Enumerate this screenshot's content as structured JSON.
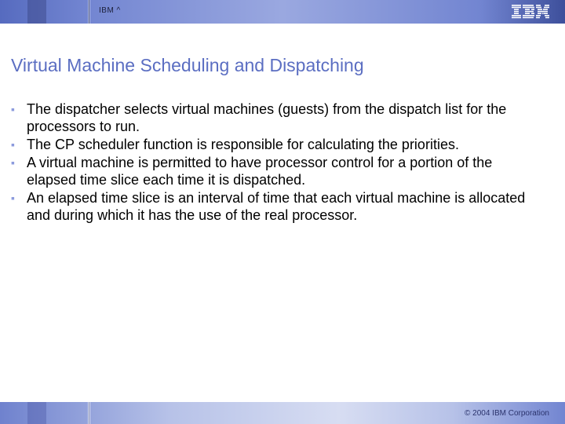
{
  "header": {
    "brand": "IBM ^",
    "logo_alt": "IBM"
  },
  "title": "Virtual Machine Scheduling and Dispatching",
  "bullets": [
    "The dispatcher selects virtual machines (guests) from the dispatch list for the processors to run.",
    "The CP scheduler function is responsible for calculating the priorities.",
    "A virtual machine is permitted to have processor control for a portion of the elapsed time slice each time it is dispatched.",
    "An elapsed time slice is an interval of time that each virtual machine is allocated and during which it has the use of the real processor."
  ],
  "footer": {
    "copyright": "© 2004 IBM Corporation"
  }
}
